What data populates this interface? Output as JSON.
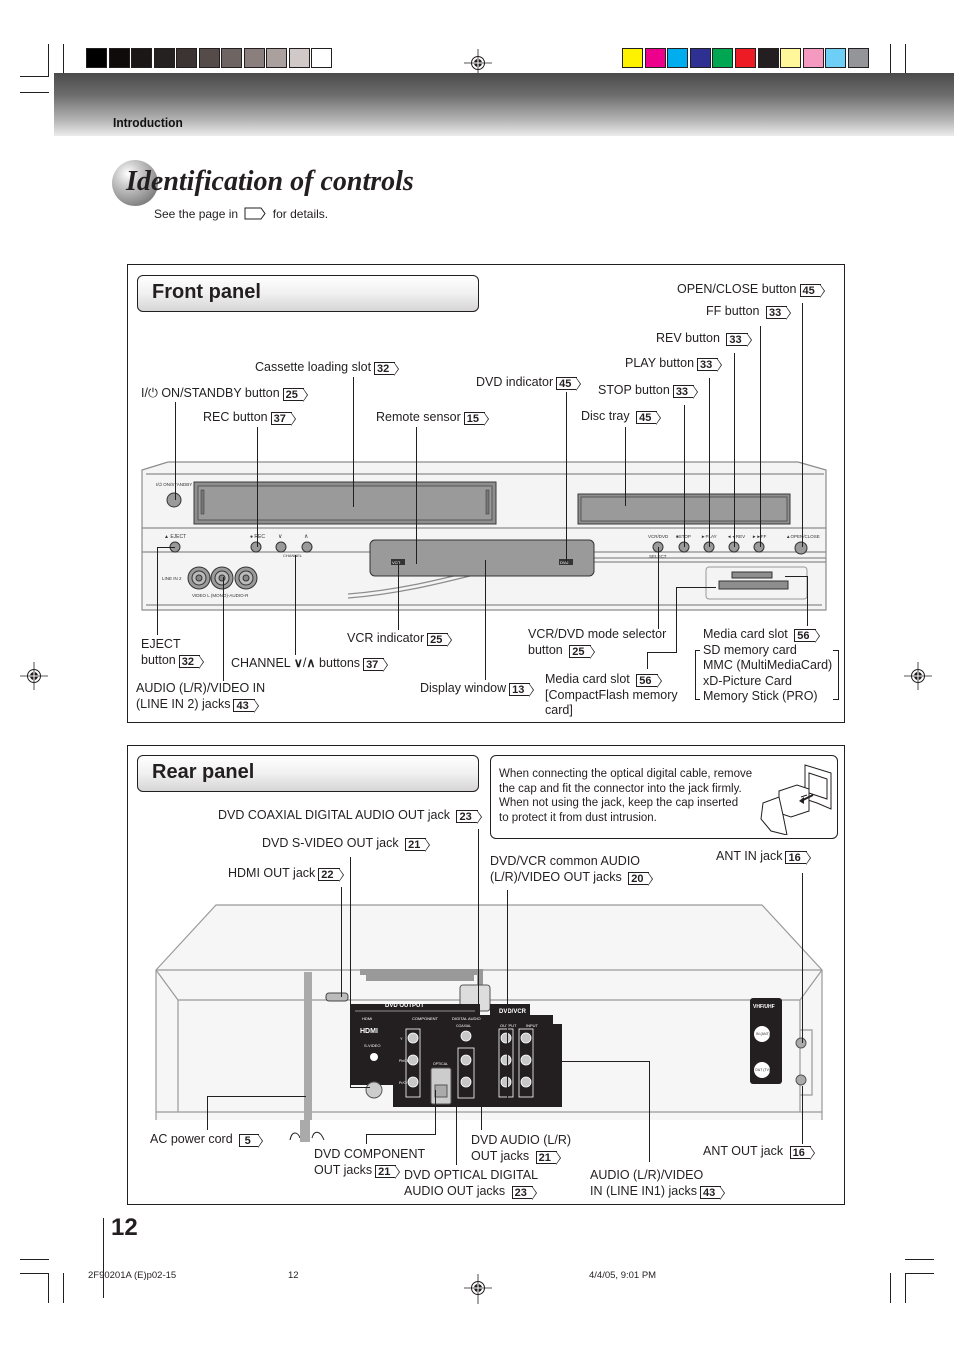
{
  "print_marks": {
    "gray_swatches": [
      "#000000",
      "#0e0b0a",
      "#1b1716",
      "#252120",
      "#3c3432",
      "#554b48",
      "#6e6461",
      "#8a7f7c",
      "#aaa09d",
      "#d1c9c7",
      "#ffffff"
    ],
    "color_swatches": [
      "#fff200",
      "#ec008c",
      "#00aeef",
      "#2e3192",
      "#00a651",
      "#ed1c24",
      "#231f20",
      "#fff799",
      "#f49ac1",
      "#6dcff6",
      "#939598"
    ]
  },
  "header": {
    "section": "Introduction"
  },
  "title": {
    "text": "Identification of controls",
    "see_page_prefix": "See the page in",
    "see_page_suffix": "for details."
  },
  "front_panel": {
    "heading": "Front panel",
    "labels": {
      "open_close": {
        "text": "OPEN/CLOSE button",
        "page": "45"
      },
      "ff": {
        "text": "FF button",
        "page": "33"
      },
      "rev": {
        "text": "REV button",
        "page": "33"
      },
      "play": {
        "text": "PLAY button",
        "page": "33"
      },
      "stop": {
        "text": "STOP button",
        "page": "33"
      },
      "disc_tray": {
        "text": "Disc tray",
        "page": "45"
      },
      "dvd_indicator": {
        "text": "DVD indicator",
        "page": "45"
      },
      "cassette_slot": {
        "text": "Cassette loading slot",
        "page": "32"
      },
      "on_standby": {
        "symbol": "I/⏻",
        "text": "ON/STANDBY button",
        "page": "25"
      },
      "rec": {
        "text": "REC button",
        "page": "37"
      },
      "remote_sensor": {
        "text": "Remote sensor",
        "page": "15"
      },
      "eject": {
        "line1": "EJECT",
        "line2": "button",
        "page": "32"
      },
      "channel": {
        "prefix": "CHANNEL",
        "down": "∨",
        "sep": "/",
        "up": "∧",
        "suffix": "buttons",
        "page": "37"
      },
      "audio_video_in": {
        "line1": "AUDIO (L/R)/VIDEO IN",
        "line2": "(LINE IN 2) jacks",
        "page": "43"
      },
      "vcr_indicator": {
        "text": "VCR indicator",
        "page": "25"
      },
      "display_window": {
        "text": "Display window",
        "page": "13"
      },
      "vcr_dvd_selector": {
        "line1": "VCR/DVD mode selector",
        "line2": "button",
        "page": "25"
      },
      "media_card_cf": {
        "line1": "Media card slot",
        "line2": "[CompactFlash memory",
        "line3": "card]",
        "page": "56"
      },
      "media_card_sd": {
        "heading": "Media card slot",
        "page": "56",
        "items": [
          "SD memory card",
          "MMC (MultiMediaCard)",
          "xD-Picture Card",
          "Memory Stick (PRO)"
        ]
      }
    },
    "device_text": {
      "on_standby": "I/⏻ ON/STANDBY",
      "eject": "▲ EJECT",
      "rec": "● REC",
      "ch_down": "∨",
      "ch_up": "∧",
      "channel": "CHANNEL",
      "line_in2": "LINE IN 2",
      "jacks": "VIDEO   L (MONO)-AUDIO-R",
      "vcr_badge": "VCR",
      "dvd_badge": "DVD",
      "vcr_dvd": "VCR/DVD",
      "select": "SELECT",
      "stop": "■STOP",
      "play": "►PLAY",
      "rev": "◄◄REV",
      "ff": "►►FF",
      "open_close": "▲OPEN/CLOSE"
    }
  },
  "rear_panel": {
    "heading": "Rear panel",
    "note": [
      "When connecting the optical digital cable, remove",
      "the cap and fit the connector into the jack firmly.",
      "When not using the jack, keep the cap inserted",
      "to protect it from dust intrusion."
    ],
    "labels": {
      "coaxial": {
        "text": "DVD COAXIAL DIGITAL AUDIO OUT jack",
        "page": "23"
      },
      "s_video": {
        "text": "DVD S-VIDEO OUT jack",
        "page": "21"
      },
      "hdmi": {
        "text": "HDMI OUT jack",
        "page": "22"
      },
      "common_out": {
        "line1": "DVD/VCR common AUDIO",
        "line2": "(L/R)/VIDEO OUT jacks",
        "page": "20"
      },
      "ant_in": {
        "text": "ANT IN jack",
        "page": "16"
      },
      "ac_cord": {
        "text": "AC power cord",
        "page": "5"
      },
      "component": {
        "line1": "DVD COMPONENT",
        "line2": "OUT jacks",
        "page": "21"
      },
      "optical": {
        "line1": "DVD OPTICAL DIGITAL",
        "line2": "AUDIO OUT jacks",
        "page": "23"
      },
      "dvd_audio": {
        "line1": "DVD AUDIO (L/R)",
        "line2": "OUT jacks",
        "page": "21"
      },
      "line_in1": {
        "line1": "AUDIO (L/R)/VIDEO",
        "line2": "IN (LINE IN1) jacks",
        "page": "43"
      },
      "ant_out": {
        "text": "ANT OUT jack",
        "page": "16"
      }
    },
    "device_text": {
      "dvd_output": "DVD OUTPUT",
      "dvd_vcr": "DVD/VCR",
      "hdmi_small": "HDMI",
      "hdmi_logo": "HDMI",
      "component": "COMPONENT",
      "digital_audio": "DIGITAL AUDIO",
      "coaxial": "COAXIAL",
      "optical": "OPTICAL",
      "output": "OUTPUT",
      "input": "INPUT",
      "s_video": "S-VIDEO",
      "y": "Y",
      "pb": "Pb/Cb",
      "pr": "Pr/Cr",
      "vhf_uhf": "VHF/UHF",
      "ant_in": "IN (ANT)",
      "ant_out": "OUT (TV)"
    }
  },
  "footer": {
    "page_number": "12",
    "doc_id": "2F90201A (E)p02-15",
    "sheet": "12",
    "timestamp": "4/4/05, 9:01 PM"
  }
}
